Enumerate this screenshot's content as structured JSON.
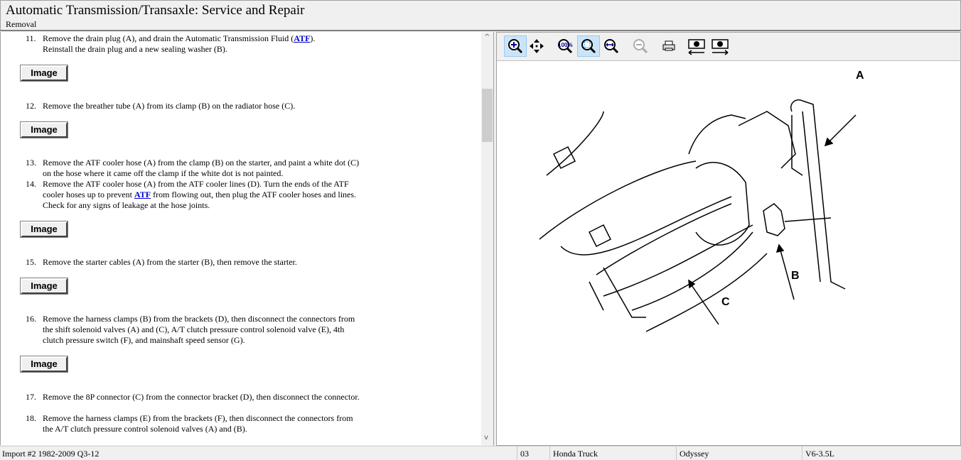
{
  "header": {
    "title": "Automatic Transmission/Transaxle:  Service and Repair",
    "subtitle": "Removal"
  },
  "steps": [
    {
      "num": "11.",
      "lines": [
        "Remove the drain plug (A), and drain the Automatic Transmission Fluid (",
        "ATF",
        "). ",
        "Reinstall the drain plug and a new sealing washer (B)."
      ]
    },
    {
      "num": "12.",
      "text": "Remove the breather tube (A) from its clamp (B) on the radiator hose (C)."
    },
    {
      "num": "13.",
      "text": "Remove the ATF cooler hose (A) from the clamp (B) on the starter, and paint a white dot (C) on the hose where it came off the clamp if the white dot is not painted."
    },
    {
      "num": "14.",
      "pre": "Remove the ATF cooler hose (A) from the ATF cooler lines (D). Turn the ends of the ATF cooler hoses up to prevent ",
      "link": "ATF",
      "post": " from flowing out, then plug the ATF cooler hoses and lines. Check for any signs of leakage at the hose joints."
    },
    {
      "num": "15.",
      "text": "Remove the starter cables (A) from the starter (B), then remove the starter."
    },
    {
      "num": "16.",
      "text": "Remove the harness clamps (B) from the brackets (D), then disconnect the connectors from the shift solenoid valves (A) and (C), A/T clutch pressure control solenoid valve (E), 4th clutch pressure switch (F), and mainshaft speed sensor (G)."
    },
    {
      "num": "17.",
      "text": "Remove the 8P connector (C) from the connector bracket (D), then disconnect the connector."
    },
    {
      "num": "18.",
      "text": "Remove the harness clamps (E) from the brackets (F), then disconnect the connectors from the A/T clutch pressure control solenoid valves (A) and (B)."
    }
  ],
  "image_button": "Image",
  "scroll": {
    "up": "^",
    "down": "v"
  },
  "toolbar": {
    "zoom_in": "zoom-in",
    "pan": "pan",
    "actual_size": "100%",
    "fit": "fit",
    "fit_width": "fit-width",
    "zoom_out": "zoom-out",
    "print": "print",
    "prev": "previous-image",
    "next": "next-image"
  },
  "diagram": {
    "labels": [
      "A",
      "B",
      "C"
    ]
  },
  "status": {
    "source": "Import #2 1982-2009 Q3-12",
    "code": "03",
    "make": "Honda Truck",
    "model": "Odyssey",
    "engine": "V6-3.5L"
  }
}
